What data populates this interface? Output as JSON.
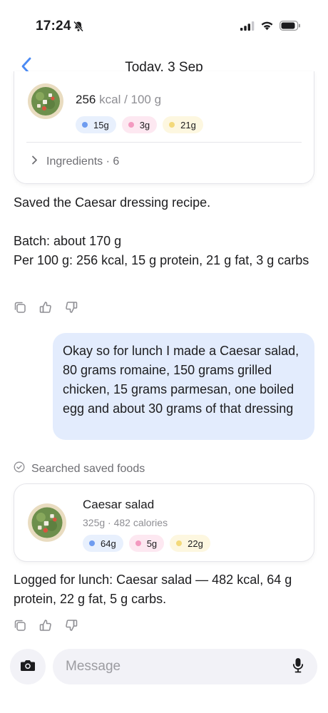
{
  "status_bar": {
    "time": "17:24"
  },
  "nav": {
    "title": "Today, 3 Sep"
  },
  "top_card": {
    "kcal_value": "256",
    "kcal_unit": "kcal / 100 g",
    "protein": "15g",
    "carbs": "3g",
    "fat": "21g",
    "ingredients_label": "Ingredients · 6"
  },
  "assistant_message_1": {
    "line1": "Saved the Caesar dressing recipe.",
    "line2": "Batch: about 170 g",
    "line3": "Per 100 g: 256 kcal, 15 g protein, 21 g fat, 3 g carbs"
  },
  "user_message": {
    "text": "Okay so for lunch I made a Caesar salad, 80 grams romaine, 150 grams grilled chicken, 15 grams parmesan, one boiled egg and about 30 grams of that dressing"
  },
  "tool_note": {
    "label": "Searched saved foods"
  },
  "food_card": {
    "name": "Caesar salad",
    "meta": "325g · 482 calories",
    "protein": "64g",
    "carbs": "5g",
    "fat": "22g"
  },
  "assistant_message_2": {
    "text": "Logged for lunch: Caesar salad — 482 kcal, 64 g protein, 22 g fat, 5 g carbs."
  },
  "composer": {
    "placeholder": "Message"
  },
  "icons": {
    "back": "chevron-left-icon",
    "bell": "bell-slash-icon",
    "copy": "copy-icon",
    "like": "thumbs-up-icon",
    "dislike": "thumbs-down-icon",
    "check": "check-circle-icon",
    "camera": "camera-icon",
    "mic": "microphone-icon"
  },
  "colors": {
    "accent": "#4a8af4",
    "user_bubble": "#e3ecfd",
    "protein": "#6e9cf0",
    "carbs": "#f39ac0",
    "fat": "#f3d97a"
  }
}
